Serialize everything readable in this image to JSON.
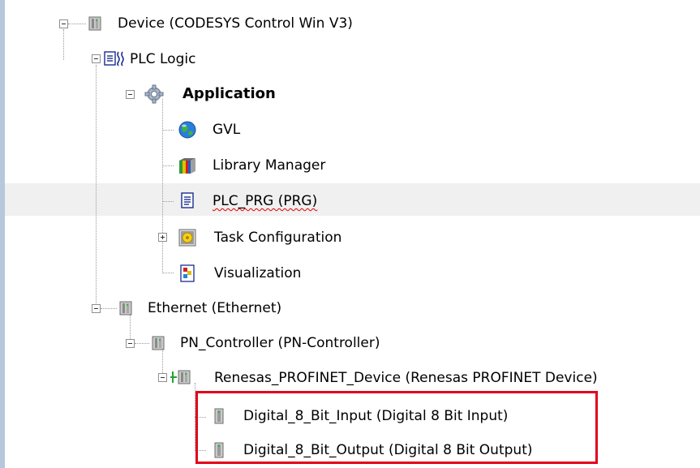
{
  "tree": {
    "device": {
      "label": "Device (CODESYS Control Win V3)",
      "icon": "device-icon"
    },
    "plc_logic": {
      "label": "PLC Logic",
      "icon": "plc-logic-icon"
    },
    "application": {
      "label": "Application",
      "icon": "gear-icon"
    },
    "gvl": {
      "label": "GVL",
      "icon": "globe-icon"
    },
    "library_manager": {
      "label": "Library Manager",
      "icon": "books-icon"
    },
    "plc_prg": {
      "label": "PLC_PRG (PRG)",
      "icon": "document-icon"
    },
    "task_configuration": {
      "label": "Task Configuration",
      "icon": "task-config-icon"
    },
    "visualization": {
      "label": "Visualization",
      "icon": "visualization-icon"
    },
    "ethernet": {
      "label": "Ethernet (Ethernet)",
      "icon": "device-icon"
    },
    "pn_controller": {
      "label": "PN_Controller (PN-Controller)",
      "icon": "device-icon"
    },
    "renesas": {
      "label": "Renesas_PROFINET_Device (Renesas PROFINET Device)",
      "icon": "profinet-device-icon"
    },
    "digital_input": {
      "label": "Digital_8_Bit_Input (Digital 8 Bit Input)",
      "icon": "module-icon"
    },
    "digital_output": {
      "label": "Digital_8_Bit_Output (Digital 8 Bit Output)",
      "icon": "module-icon"
    }
  },
  "colors": {
    "highlight_box": "#e3001b",
    "selected_row": "#f0f0f0",
    "left_border": "#b7c7dc"
  }
}
